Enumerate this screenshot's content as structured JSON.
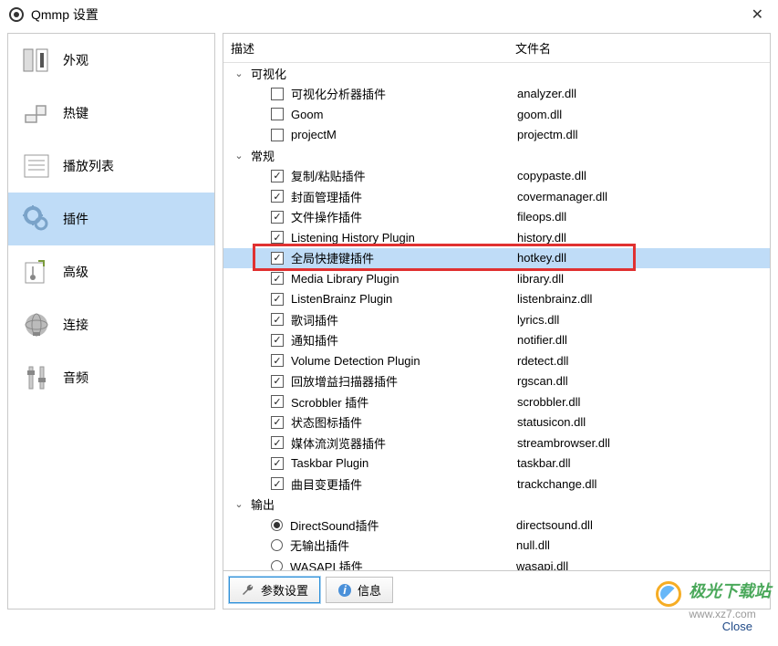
{
  "window": {
    "title": "Qmmp 设置"
  },
  "sidebar": [
    {
      "id": "appearance",
      "label": "外观"
    },
    {
      "id": "hotkeys",
      "label": "热键"
    },
    {
      "id": "playlist",
      "label": "播放列表"
    },
    {
      "id": "plugins",
      "label": "插件",
      "selected": true
    },
    {
      "id": "advanced",
      "label": "高级"
    },
    {
      "id": "connect",
      "label": "连接"
    },
    {
      "id": "audio",
      "label": "音频"
    }
  ],
  "columns": {
    "desc": "描述",
    "file": "文件名"
  },
  "tree": [
    {
      "type": "group",
      "label": "可视化",
      "expanded": true,
      "children": [
        {
          "label": "可视化分析器插件",
          "file": "analyzer.dll",
          "checked": false
        },
        {
          "label": "Goom",
          "file": "goom.dll",
          "checked": false
        },
        {
          "label": "projectM",
          "file": "projectm.dll",
          "checked": false
        }
      ]
    },
    {
      "type": "group",
      "label": "常规",
      "expanded": true,
      "children": [
        {
          "label": "复制/粘贴插件",
          "file": "copypaste.dll",
          "checked": true
        },
        {
          "label": "封面管理插件",
          "file": "covermanager.dll",
          "checked": true
        },
        {
          "label": "文件操作插件",
          "file": "fileops.dll",
          "checked": true
        },
        {
          "label": "Listening History Plugin",
          "file": "history.dll",
          "checked": true
        },
        {
          "label": "全局快捷键插件",
          "file": "hotkey.dll",
          "checked": true,
          "selected": true,
          "highlight": true
        },
        {
          "label": "Media Library Plugin",
          "file": "library.dll",
          "checked": true
        },
        {
          "label": "ListenBrainz Plugin",
          "file": "listenbrainz.dll",
          "checked": true
        },
        {
          "label": "歌词插件",
          "file": "lyrics.dll",
          "checked": true
        },
        {
          "label": "通知插件",
          "file": "notifier.dll",
          "checked": true
        },
        {
          "label": "Volume Detection Plugin",
          "file": "rdetect.dll",
          "checked": true
        },
        {
          "label": "回放增益扫描器插件",
          "file": "rgscan.dll",
          "checked": true
        },
        {
          "label": "Scrobbler 插件",
          "file": "scrobbler.dll",
          "checked": true
        },
        {
          "label": "状态图标插件",
          "file": "statusicon.dll",
          "checked": true
        },
        {
          "label": "媒体流浏览器插件",
          "file": "streambrowser.dll",
          "checked": true
        },
        {
          "label": "Taskbar Plugin",
          "file": "taskbar.dll",
          "checked": true
        },
        {
          "label": "曲目变更插件",
          "file": "trackchange.dll",
          "checked": true
        }
      ]
    },
    {
      "type": "group",
      "label": "输出",
      "expanded": true,
      "children": [
        {
          "label": "DirectSound插件",
          "file": "directsound.dll",
          "radio": true,
          "checked": true
        },
        {
          "label": "无输出插件",
          "file": "null.dll",
          "radio": true,
          "checked": false
        },
        {
          "label": "WASAPI 插件",
          "file": "wasapi.dll",
          "radio": true,
          "checked": false
        }
      ]
    }
  ],
  "toolbar": {
    "settings": "参数设置",
    "info": "信息"
  },
  "footer": {
    "close": "Close"
  },
  "watermark": {
    "line1": "极光下载站",
    "line2": "www.xz7.com"
  }
}
